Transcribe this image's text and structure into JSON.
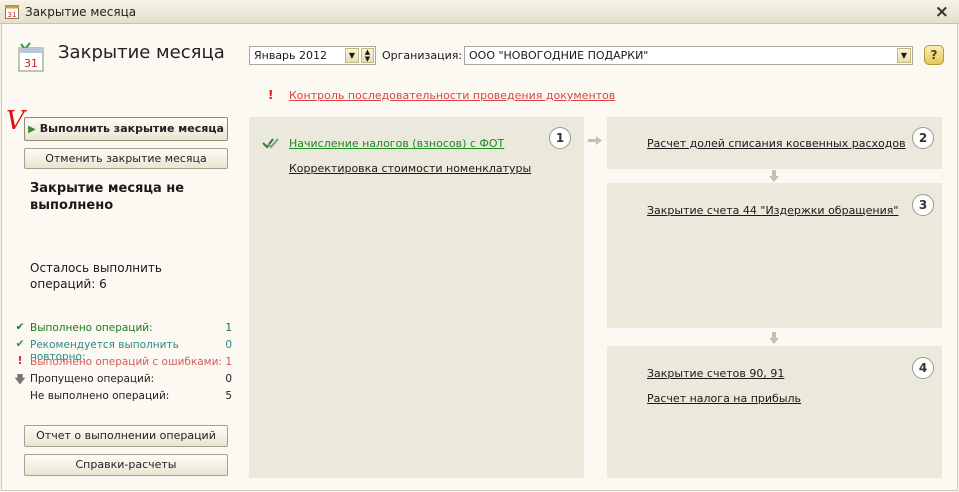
{
  "window": {
    "title": "Закрытие месяца",
    "close_glyph": "×"
  },
  "header": {
    "title": "Закрытие месяца",
    "calendar_day": "31",
    "period_value": "Январь 2012",
    "org_label": "Организация:",
    "org_value": "ООО \"НОВОГОДНИЕ ПОДАРКИ\"",
    "help_glyph": "?"
  },
  "control": {
    "mark": "!",
    "link": "Контроль последовательности проведения документов"
  },
  "annotation": {
    "mark": "V"
  },
  "actions": {
    "run": "Выполнить закрытие месяца",
    "cancel": "Отменить закрытие месяца",
    "report": "Отчет о выполнении операций",
    "refs": "Справки-расчеты"
  },
  "status": {
    "title": "Закрытие месяца не выполнено",
    "remaining": "Осталось выполнить операций: 6"
  },
  "stats": {
    "done": {
      "label": "Выполнено операций:",
      "value": "1",
      "color": "#1e7a1e"
    },
    "repeat": {
      "label": "Рекомендуется выполнить повторно:",
      "value": "0",
      "color": "#2a8a8a"
    },
    "errors": {
      "label": "Выполнено операций с ошибками:",
      "value": "1",
      "color": "#d65a5a"
    },
    "skipped": {
      "label": "Пропущено операций:",
      "value": "0"
    },
    "not_done": {
      "label": "Не выполнено операций:",
      "value": "5"
    }
  },
  "steps": {
    "s1": {
      "badge": "1",
      "items": [
        "Начисление налогов (взносов) с ФОТ",
        "Корректировка стоимости номенклатуры"
      ]
    },
    "s2": {
      "badge": "2",
      "items": [
        "Расчет долей списания косвенных расходов"
      ]
    },
    "s3": {
      "badge": "3",
      "items": [
        "Закрытие счета 44 \"Издержки обращения\""
      ]
    },
    "s4": {
      "badge": "4",
      "items": [
        "Закрытие счетов 90, 91",
        "Расчет налога на прибыль"
      ]
    }
  }
}
